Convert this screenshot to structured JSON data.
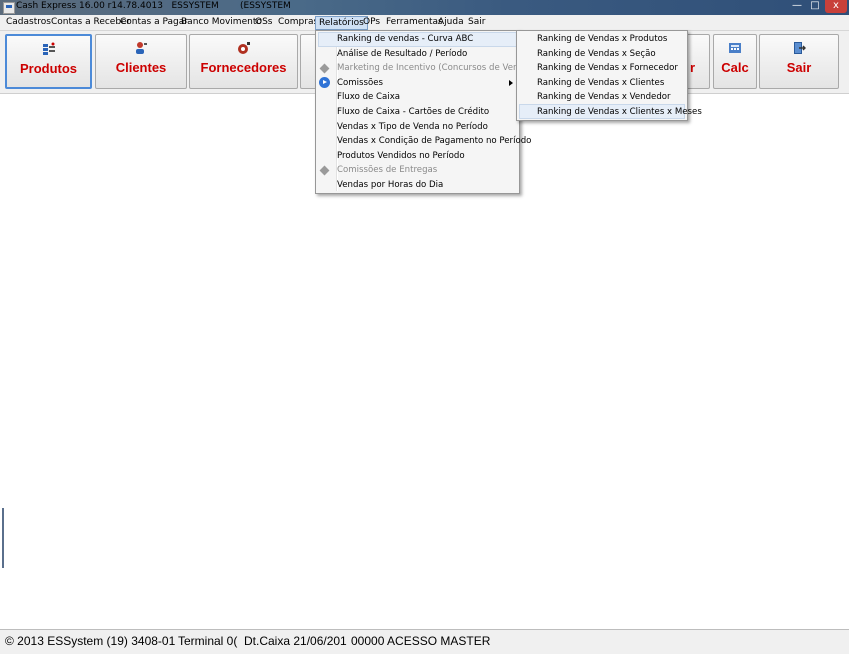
{
  "window": {
    "title": "Cash Express 16.00 r14.78.4013   ESSYSTEM",
    "title_suffix": "(ESSYSTEM",
    "controls": {
      "minimize": "—",
      "maximize": "□",
      "close": "x"
    }
  },
  "menubar": {
    "items": [
      {
        "label": "Cadastros"
      },
      {
        "label": "Contas a Receber"
      },
      {
        "label": "Contas a Pagar"
      },
      {
        "label": "Banco Movimento"
      },
      {
        "label": "OSs"
      },
      {
        "label": "Compras"
      },
      {
        "label": "Relatórios"
      },
      {
        "label": "OPs"
      },
      {
        "label": "Ferramentas"
      },
      {
        "label": "Ajuda"
      },
      {
        "label": "Sair"
      }
    ]
  },
  "toolbar": {
    "buttons": [
      {
        "label": "Produtos",
        "icon": "products-icon"
      },
      {
        "label": "Clientes",
        "icon": "clients-icon"
      },
      {
        "label": "Fornecedores",
        "icon": "suppliers-icon"
      },
      {
        "label": "r",
        "icon": ""
      },
      {
        "label": "Calc",
        "icon": "calculator-icon"
      },
      {
        "label": "Sair",
        "icon": "exit-icon"
      }
    ]
  },
  "relatorios_menu": {
    "items": [
      {
        "label": "Ranking de vendas - Curva ABC",
        "state": "highlighted"
      },
      {
        "label": "Análise de Resultado / Período",
        "state": "normal"
      },
      {
        "label": "Marketing de Incentivo (Concursos de Vendas)",
        "state": "disabled",
        "icon": "diamond-icon"
      },
      {
        "label": "Comissões",
        "state": "submenu",
        "icon": "arrow-icon"
      },
      {
        "label": "Fluxo de Caixa",
        "state": "normal"
      },
      {
        "label": "Fluxo de Caixa - Cartões de Crédito",
        "state": "normal"
      },
      {
        "label": "Vendas x Tipo de Venda no Período",
        "state": "normal"
      },
      {
        "label": "Vendas x Condição de Pagamento no Período",
        "state": "normal"
      },
      {
        "label": "Produtos Vendidos no Período",
        "state": "normal"
      },
      {
        "label": "Comissões de Entregas",
        "state": "disabled",
        "icon": "diamond-icon"
      },
      {
        "label": "Vendas por Horas do Dia",
        "state": "normal"
      }
    ]
  },
  "ranking_submenu": {
    "items": [
      {
        "label": "Ranking de Vendas x Produtos"
      },
      {
        "label": "Ranking de Vendas x Seção"
      },
      {
        "label": "Ranking de Vendas x Fornecedor"
      },
      {
        "label": "Ranking de Vendas x Clientes"
      },
      {
        "label": "Ranking de Vendas x Vendedor"
      },
      {
        "label": "Ranking de Vendas x Clientes x Meses",
        "state": "highlighted"
      }
    ]
  },
  "statusbar": {
    "copyright": "© 2013 ESSystem (19) 3408-01",
    "terminal": "Terminal 0(",
    "dtcaixa": "Dt.Caixa 21/06/201",
    "access": "00000 ACESSO MASTER"
  },
  "colors": {
    "button_label": "#cc0000",
    "menu_highlight": "#e6eef8",
    "titlebar": "#3a5a80"
  }
}
